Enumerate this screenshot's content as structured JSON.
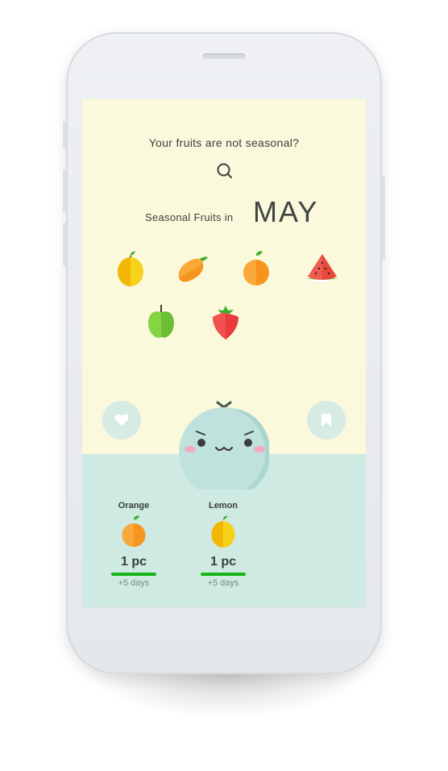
{
  "search": {
    "title": "Your fruits are not seasonal?",
    "icon": "search-icon"
  },
  "seasonal": {
    "label": "Seasonal Fruits in",
    "month": "MAY"
  },
  "fruits": [
    {
      "name": "lemon-icon"
    },
    {
      "name": "mango-icon"
    },
    {
      "name": "orange-icon"
    },
    {
      "name": "watermelon-icon"
    },
    {
      "name": "apple-icon"
    },
    {
      "name": "strawberry-icon"
    }
  ],
  "actions": {
    "favorite_icon": "heart-icon",
    "bookmark_icon": "bookmark-icon"
  },
  "basket": [
    {
      "name": "Orange",
      "qty": "1 pc",
      "days": "+5 days",
      "progress": 1.0
    },
    {
      "name": "Lemon",
      "qty": "1 pc",
      "days": "+5 days",
      "progress": 1.0
    }
  ],
  "colors": {
    "screen_bg": "#faf9dc",
    "bottom_bg": "#cfe9e3",
    "accent": "#14b814",
    "orange": "#f7941d",
    "lemon": "#f7d11a"
  }
}
